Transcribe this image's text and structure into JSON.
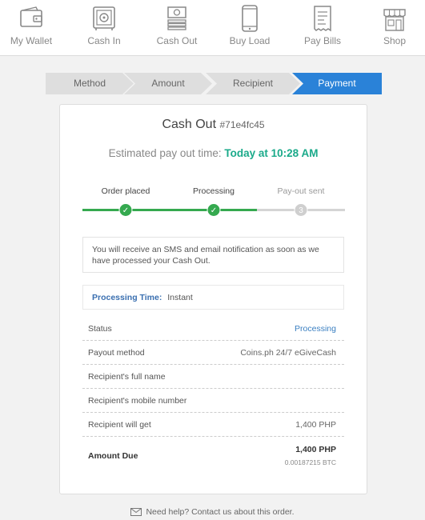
{
  "nav": {
    "items": [
      {
        "label": "My Wallet",
        "icon": "wallet-icon"
      },
      {
        "label": "Cash In",
        "icon": "safe-icon"
      },
      {
        "label": "Cash Out",
        "icon": "cash-out-icon"
      },
      {
        "label": "Buy Load",
        "icon": "phone-icon"
      },
      {
        "label": "Pay Bills",
        "icon": "receipt-icon"
      },
      {
        "label": "Shop",
        "icon": "shop-icon"
      }
    ]
  },
  "stepper": {
    "steps": [
      "Method",
      "Amount",
      "Recipient",
      "Payment"
    ],
    "active_index": 3
  },
  "card": {
    "title": "Cash Out",
    "order_id": "#71e4fc45",
    "eta_label": "Estimated pay out time:",
    "eta_value": "Today at 10:28 AM",
    "progress": {
      "steps": [
        "Order placed",
        "Processing",
        "Pay-out sent"
      ],
      "done_marker": "✓",
      "pending_marker": "3",
      "completed": 2
    },
    "notice": "You will receive an SMS and email notification as soon as we have processed your Cash Out.",
    "processing_time_label": "Processing Time:",
    "processing_time_value": "Instant",
    "details": {
      "status_label": "Status",
      "status_value": "Processing",
      "payout_method_label": "Payout method",
      "payout_method_value": "Coins.ph 24/7 eGiveCash",
      "recipient_name_label": "Recipient's full name",
      "recipient_name_value": "",
      "recipient_mobile_label": "Recipient's mobile number",
      "recipient_mobile_value": "",
      "recipient_gets_label": "Recipient will get",
      "recipient_gets_value": "1,400 PHP",
      "amount_due_label": "Amount Due",
      "amount_due_value": "1,400 PHP",
      "amount_due_btc": "0.00187215 BTC"
    }
  },
  "help": {
    "text": "Need help? Contact us about this order.",
    "icon": "envelope-icon"
  },
  "colors": {
    "accent_blue": "#2a82d8",
    "success_green": "#35a94f",
    "eta_teal": "#1aaa8a",
    "link_blue": "#3a7fc1"
  }
}
